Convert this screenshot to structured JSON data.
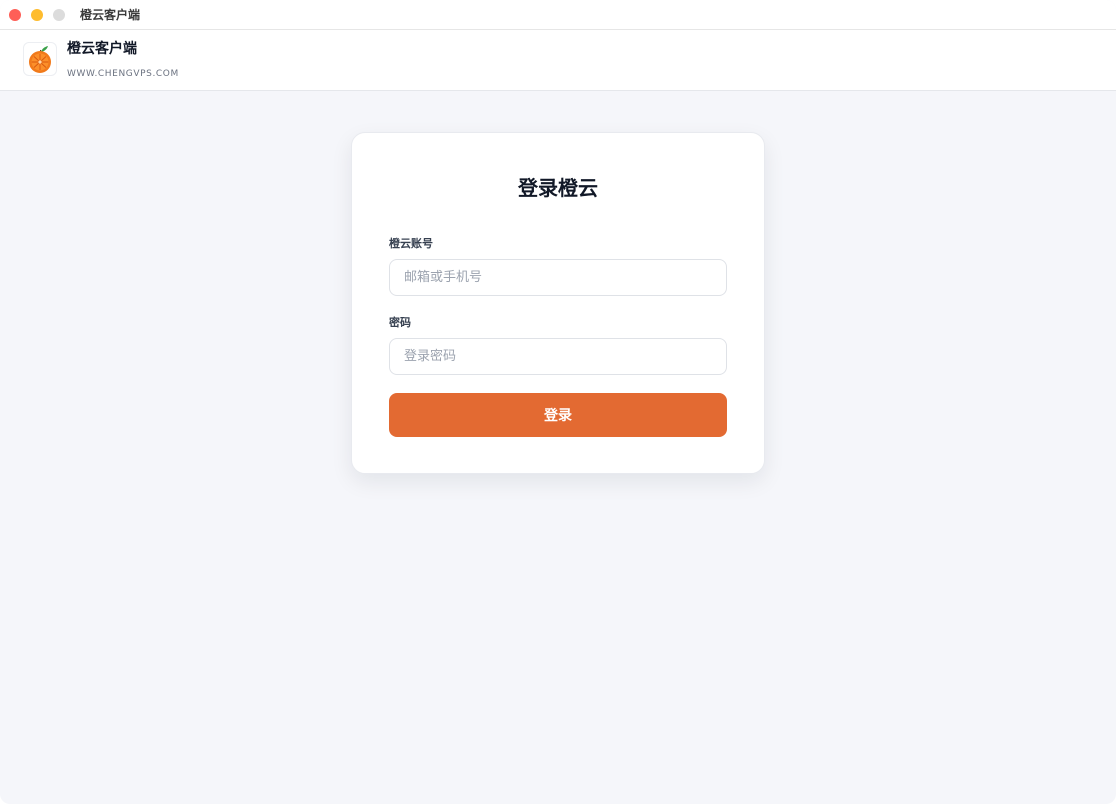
{
  "window": {
    "title": "橙云客户端"
  },
  "header": {
    "app_name": "橙云客户端",
    "url": "WWW.CHENGVPS.COM",
    "logo_icon": "orange-fruit-icon"
  },
  "login_card": {
    "title": "登录橙云",
    "account": {
      "label": "橙云账号",
      "value": "",
      "placeholder": "邮箱或手机号"
    },
    "password": {
      "label": "密码",
      "value": "",
      "placeholder": "登录密码"
    },
    "submit_label": "登录"
  },
  "colors": {
    "accent": "#e36a32",
    "background": "#f5f6fa",
    "card": "#ffffff",
    "traffic_close": "#fe5f57",
    "traffic_minimize": "#febc2e",
    "traffic_maximize": "#dcdcdc"
  }
}
